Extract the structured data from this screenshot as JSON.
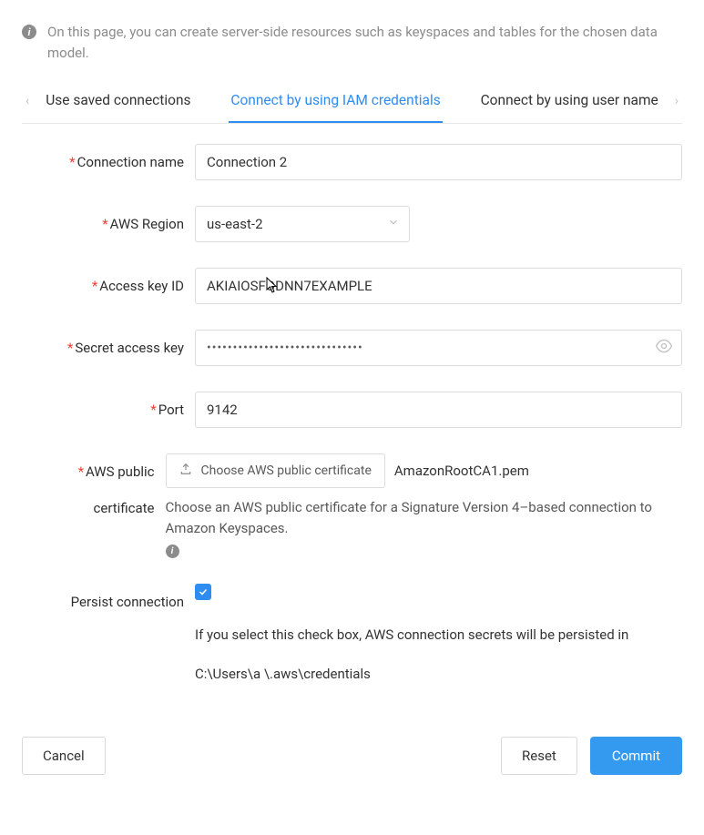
{
  "info_text": "On this page, you can create server-side resources such as keyspaces and tables for the chosen data model.",
  "tabs": {
    "left_scroll_glyph": "‹",
    "right_scroll_glyph": "›",
    "items": [
      {
        "label": "Use saved connections",
        "active": false
      },
      {
        "label": "Connect by using IAM credentials",
        "active": true
      },
      {
        "label": "Connect by using user name",
        "active": false
      }
    ]
  },
  "fields": {
    "connection_name": {
      "label": "Connection name",
      "value": "Connection 2"
    },
    "aws_region": {
      "label": "AWS Region",
      "value": "us-east-2"
    },
    "access_key_id": {
      "label": "Access key ID",
      "value": "AKIAIOSFODNN7EXAMPLE"
    },
    "secret_access_key": {
      "label": "Secret access key",
      "masked_value": "••••••••••••••••••••••••••••••"
    },
    "port": {
      "label": "Port",
      "value": "9142"
    },
    "public_cert": {
      "label": "AWS public certificate",
      "button_label": "Choose AWS public certificate",
      "filename": "AmazonRootCA1.pem",
      "helper": "Choose an AWS public certificate for a Signature Version 4–based connection to Amazon Keyspaces."
    },
    "persist": {
      "label": "Persist connection",
      "helper": "If you select this check box, AWS connection secrets will be persisted in",
      "path": "C:\\Users\\a     \\.aws\\credentials"
    }
  },
  "footer": {
    "cancel": "Cancel",
    "reset": "Reset",
    "commit": "Commit"
  },
  "icons": {
    "info_glyph": "i"
  }
}
